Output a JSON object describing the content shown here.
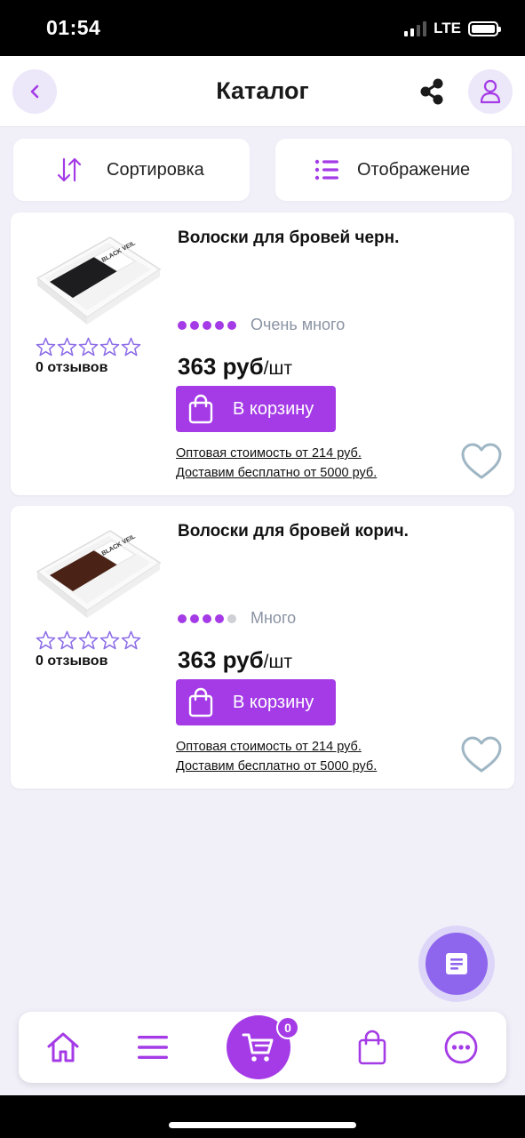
{
  "status": {
    "time": "01:54",
    "network": "LTE"
  },
  "header": {
    "title": "Каталог"
  },
  "toolbar": {
    "sort_label": "Сортировка",
    "view_label": "Отображение"
  },
  "products": [
    {
      "title": "Волоски для бровей черн.",
      "rating_stars": 0,
      "reviews": "0 отзывов",
      "availability_level": 5,
      "availability_max": 5,
      "availability": "Очень много",
      "price": "363 руб",
      "price_unit": "/шт",
      "cart_label": "В корзину",
      "wholesale": "Оптовая стоимость от 214 руб.",
      "delivery": "Доставим бесплатно от 5000 руб.",
      "image_brand": "BLACK VEIL",
      "strip_color": "#1d1d1f"
    },
    {
      "title": "Волоски для бровей корич.",
      "rating_stars": 0,
      "reviews": "0 отзывов",
      "availability_level": 4,
      "availability_max": 5,
      "availability": "Много",
      "price": "363 руб",
      "price_unit": "/шт",
      "cart_label": "В корзину",
      "wholesale": "Оптовая стоимость от 214 руб.",
      "delivery": "Доставим бесплатно от 5000 руб.",
      "image_brand": "BLACK VEIL",
      "strip_color": "#4a2216"
    }
  ],
  "bottom_nav": {
    "cart_count": "0"
  },
  "colors": {
    "accent": "#a43be6",
    "fab": "#8e66ee",
    "background": "#f1f0f9",
    "heart": "#9fb6c4"
  }
}
